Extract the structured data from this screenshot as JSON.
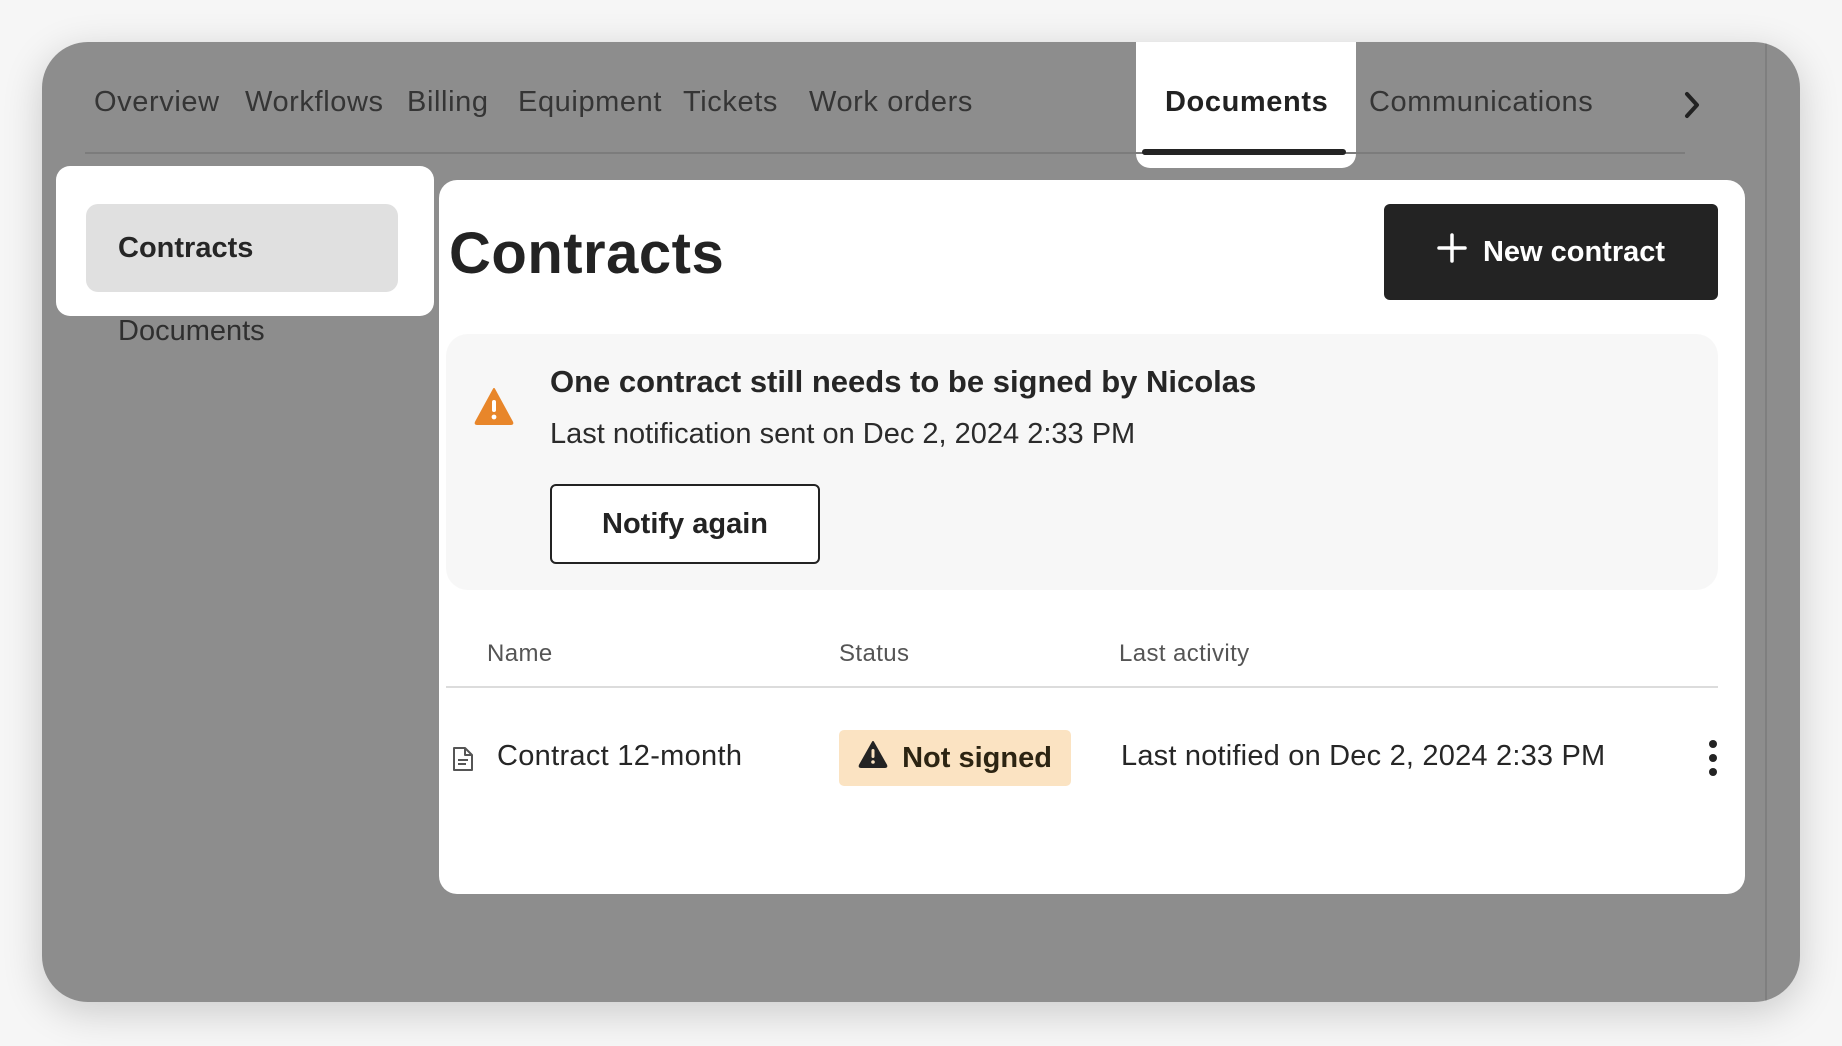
{
  "tabs": [
    {
      "label": "Overview"
    },
    {
      "label": "Workflows"
    },
    {
      "label": "Billing"
    },
    {
      "label": "Equipment"
    },
    {
      "label": "Tickets"
    },
    {
      "label": "Work orders"
    },
    {
      "label": "Documents"
    },
    {
      "label": "Communications"
    }
  ],
  "active_tab": "Documents",
  "sidebar": {
    "items": [
      {
        "label": "Contracts",
        "active": true
      },
      {
        "label": "Documents",
        "active": false
      }
    ]
  },
  "main": {
    "title": "Contracts",
    "new_button_label": "New contract",
    "alert": {
      "title": "One contract still needs to be signed by Nicolas",
      "subtitle": "Last notification sent on Dec 2, 2024 2:33 PM",
      "button_label": "Notify again",
      "icon": "warning-icon",
      "color": "#e8862a"
    },
    "table": {
      "columns": [
        "Name",
        "Status",
        "Last activity"
      ],
      "rows": [
        {
          "name": "Contract 12-month",
          "status": "Not signed",
          "last_activity": "Last notified on Dec 2, 2024 2:33 PM"
        }
      ]
    }
  },
  "colors": {
    "frame": "#8d8d8d",
    "dark": "#232323",
    "badge_bg": "#fbe3c2",
    "alert_bg": "#f7f7f7"
  }
}
